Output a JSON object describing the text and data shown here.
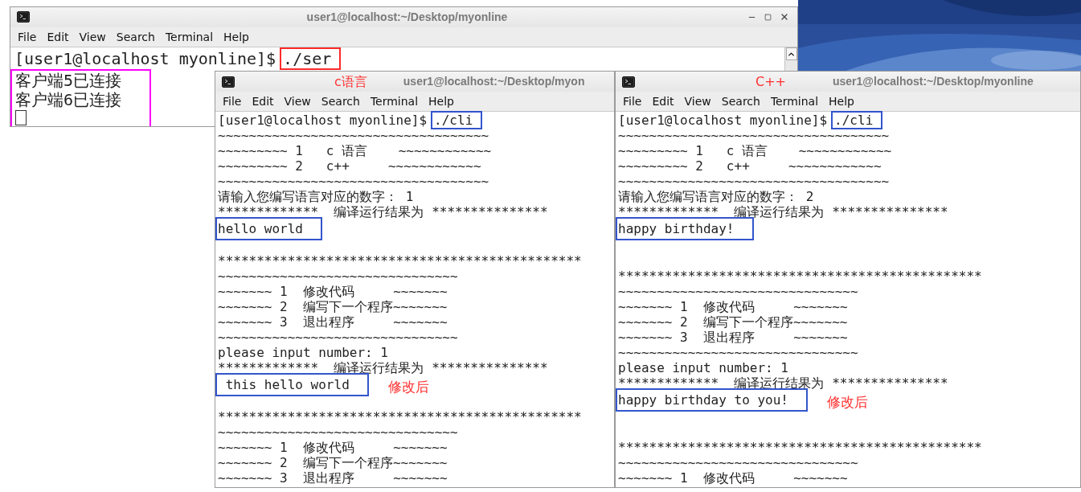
{
  "windows": [
    {
      "title": "user1@localhost:~/Desktop/myonline",
      "window_buttons": true,
      "menu": [
        "File",
        "Edit",
        "View",
        "Search",
        "Terminal",
        "Help"
      ],
      "lines": [
        {
          "kind": "prompt",
          "text": "[user1@localhost myonline]$",
          "command": "./ser",
          "color": "#ff2a2a"
        },
        {
          "kind": "group",
          "color": "#ff00ff",
          "cursor": true,
          "lines": [
            {
              "kind": "text",
              "text": "客户端5已连接"
            },
            {
              "kind": "text",
              "text": "客户端6已连接"
            }
          ]
        }
      ]
    },
    {
      "title": "user1@localhost:~/Desktop/myon",
      "title_note": "c语言",
      "window_buttons": false,
      "menu": [
        "File",
        "Edit",
        "View",
        "Search",
        "Terminal",
        "Help"
      ],
      "lines": [
        {
          "kind": "prompt",
          "text": "[user1@localhost myonline]$",
          "command": "./cli",
          "color": "#3355cc"
        },
        {
          "kind": "text",
          "text": "~~~~~~~~~~~~~~~~~~~~~~~~~~~~~~~~~~~"
        },
        {
          "kind": "text",
          "text": "~~~~~~~~~ 1   c 语言    ~~~~~~~~~~~~"
        },
        {
          "kind": "text",
          "text": "~~~~~~~~~ 2   c++     ~~~~~~~~~~~~"
        },
        {
          "kind": "text",
          "text": "~~~~~~~~~~~~~~~~~~~~~~~~~~~~~~~~~~~"
        },
        {
          "kind": "text",
          "text": "请输入您编写语言对应的数字： 1"
        },
        {
          "kind": "text",
          "text": "*************  编译运行结果为 ***************"
        },
        {
          "kind": "boxed",
          "text": "hello world",
          "color": "#3355cc"
        },
        {
          "kind": "blank"
        },
        {
          "kind": "text",
          "text": "***********************************************"
        },
        {
          "kind": "text",
          "text": "~~~~~~~~~~~~~~~~~~~~~~~~~~~~~~~"
        },
        {
          "kind": "text",
          "text": "~~~~~~~ 1  修改代码     ~~~~~~~"
        },
        {
          "kind": "text",
          "text": "~~~~~~~ 2  编写下一个程序~~~~~~~"
        },
        {
          "kind": "text",
          "text": "~~~~~~~ 3  退出程序     ~~~~~~~"
        },
        {
          "kind": "text",
          "text": "~~~~~~~~~~~~~~~~~~~~~~~~~~~~~~~"
        },
        {
          "kind": "text",
          "text": "please input number: 1"
        },
        {
          "kind": "text",
          "text": "*************  编译运行结果为 ***************"
        },
        {
          "kind": "boxed",
          "text": " this hello world",
          "color": "#3355cc",
          "note": "修改后"
        },
        {
          "kind": "blank"
        },
        {
          "kind": "text",
          "text": "***********************************************"
        },
        {
          "kind": "text",
          "text": "~~~~~~~~~~~~~~~~~~~~~~~~~~~~~~~"
        },
        {
          "kind": "text",
          "text": "~~~~~~~ 1  修改代码     ~~~~~~~"
        },
        {
          "kind": "text",
          "text": "~~~~~~~ 2  编写下一个程序~~~~~~~"
        },
        {
          "kind": "text",
          "text": "~~~~~~~ 3  退出程序     ~~~~~~~"
        }
      ]
    },
    {
      "title": "user1@localhost:~/Desktop/myonline",
      "title_note": "C++",
      "window_buttons": false,
      "menu": [
        "File",
        "Edit",
        "View",
        "Search",
        "Terminal",
        "Help"
      ],
      "lines": [
        {
          "kind": "prompt",
          "text": "[user1@localhost myonline]$",
          "command": "./cli",
          "color": "#3355cc"
        },
        {
          "kind": "text",
          "text": "~~~~~~~~~~~~~~~~~~~~~~~~~~~~~~~~~~~"
        },
        {
          "kind": "text",
          "text": "~~~~~~~~~ 1   c 语言    ~~~~~~~~~~~~"
        },
        {
          "kind": "text",
          "text": "~~~~~~~~~ 2   c++     ~~~~~~~~~~~~"
        },
        {
          "kind": "text",
          "text": "~~~~~~~~~~~~~~~~~~~~~~~~~~~~~~~~~~~"
        },
        {
          "kind": "text",
          "text": "请输入您编写语言对应的数字： 2"
        },
        {
          "kind": "text",
          "text": "*************  编译运行结果为 ***************"
        },
        {
          "kind": "boxed",
          "text": "happy birthday!",
          "color": "#3355cc"
        },
        {
          "kind": "blank"
        },
        {
          "kind": "blank"
        },
        {
          "kind": "text",
          "text": "***********************************************"
        },
        {
          "kind": "text",
          "text": "~~~~~~~~~~~~~~~~~~~~~~~~~~~~~~~"
        },
        {
          "kind": "text",
          "text": "~~~~~~~ 1  修改代码     ~~~~~~~"
        },
        {
          "kind": "text",
          "text": "~~~~~~~ 2  编写下一个程序~~~~~~~"
        },
        {
          "kind": "text",
          "text": "~~~~~~~ 3  退出程序     ~~~~~~~"
        },
        {
          "kind": "text",
          "text": "~~~~~~~~~~~~~~~~~~~~~~~~~~~~~~~"
        },
        {
          "kind": "text",
          "text": "please input number: 1"
        },
        {
          "kind": "text",
          "text": "*************  编译运行结果为 ***************"
        },
        {
          "kind": "boxed",
          "text": "happy birthday to you!",
          "color": "#3355cc",
          "note": "修改后"
        },
        {
          "kind": "blank"
        },
        {
          "kind": "blank"
        },
        {
          "kind": "text",
          "text": "***********************************************"
        },
        {
          "kind": "text",
          "text": "~~~~~~~~~~~~~~~~~~~~~~~~~~~~~~~"
        },
        {
          "kind": "text",
          "text": "~~~~~~~ 1  修改代码     ~~~~~~~"
        }
      ]
    }
  ]
}
